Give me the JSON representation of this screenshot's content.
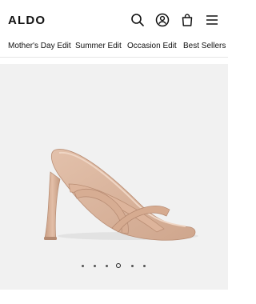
{
  "brand": {
    "logo_text": "ALDO"
  },
  "header_icons": [
    "search-icon",
    "account-icon",
    "bag-icon",
    "menu-icon"
  ],
  "nav": {
    "items": [
      {
        "label": "Mother's Day Edit"
      },
      {
        "label": "Summer Edit"
      },
      {
        "label": "Occasion Edit"
      },
      {
        "label": "Best Sellers"
      }
    ]
  },
  "carousel": {
    "slide_count": 6,
    "active_index": 3
  },
  "colors": {
    "background": "#ffffff",
    "gallery_bg": "#f1f1f1",
    "product": "#d9b49d",
    "text": "#111111"
  }
}
